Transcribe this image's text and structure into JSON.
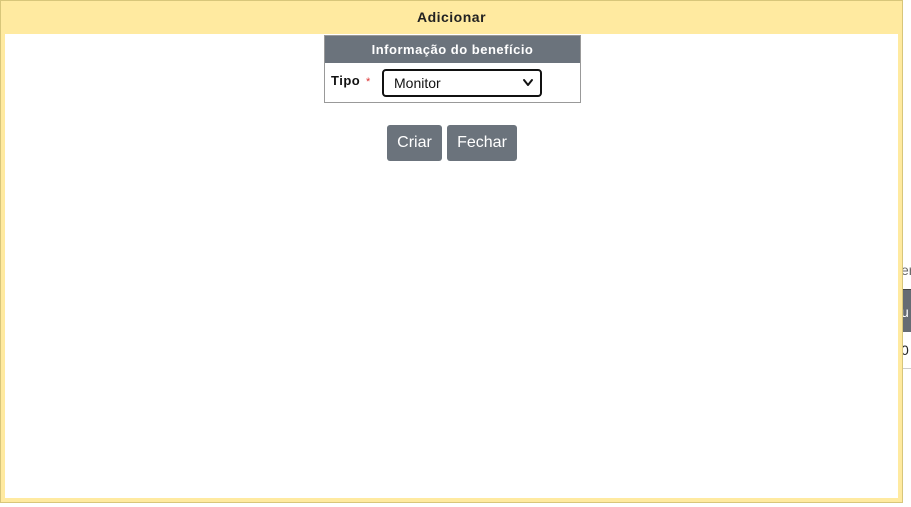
{
  "dialog": {
    "title": "Adicionar"
  },
  "info_box": {
    "header": "Informação do benefício",
    "field_label": "Tipo",
    "required_mark": "*",
    "select_value": "Monitor"
  },
  "buttons": {
    "create_label": "Criar",
    "close_label": "Fechar"
  },
  "background": {
    "text_1": "er",
    "text_2": "u",
    "text_3": "0"
  }
}
